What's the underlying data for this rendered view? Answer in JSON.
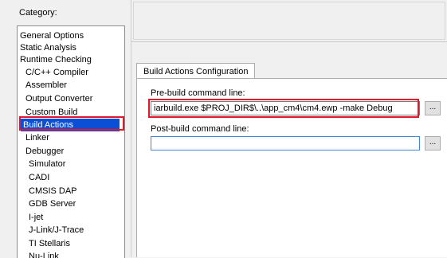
{
  "category": {
    "label": "Category:",
    "items": [
      {
        "label": "General Options",
        "indent": false,
        "selected": false
      },
      {
        "label": "Static Analysis",
        "indent": false,
        "selected": false
      },
      {
        "label": "Runtime Checking",
        "indent": false,
        "selected": false
      },
      {
        "label": "C/C++ Compiler",
        "indent": true,
        "selected": false
      },
      {
        "label": "Assembler",
        "indent": true,
        "selected": false
      },
      {
        "label": "Output Converter",
        "indent": true,
        "selected": false
      },
      {
        "label": "Custom Build",
        "indent": true,
        "selected": false
      },
      {
        "label": "Build Actions",
        "indent": true,
        "selected": true
      },
      {
        "label": "Linker",
        "indent": true,
        "selected": false
      },
      {
        "label": "Debugger",
        "indent": true,
        "selected": false
      },
      {
        "label": "Simulator",
        "indent": true,
        "selected": false
      },
      {
        "label": "CADI",
        "indent": true,
        "selected": false
      },
      {
        "label": "CMSIS DAP",
        "indent": true,
        "selected": false
      },
      {
        "label": "GDB Server",
        "indent": true,
        "selected": false
      },
      {
        "label": "I-jet",
        "indent": true,
        "selected": false
      },
      {
        "label": "J-Link/J-Trace",
        "indent": true,
        "selected": false
      },
      {
        "label": "TI Stellaris",
        "indent": true,
        "selected": false
      },
      {
        "label": "Nu-Link",
        "indent": true,
        "selected": false
      }
    ]
  },
  "tab": {
    "label": "Build Actions Configuration"
  },
  "prebuild": {
    "label": "Pre-build command line:",
    "value": "iarbuild.exe $PROJ_DIR$\\..\\app_cm4\\cm4.ewp -make Debug",
    "browse_label": "..."
  },
  "postbuild": {
    "label": "Post-build command line:",
    "value": "",
    "browse_label": "..."
  },
  "colors": {
    "selection": "#0a4fd6",
    "highlight": "#e0182e"
  }
}
